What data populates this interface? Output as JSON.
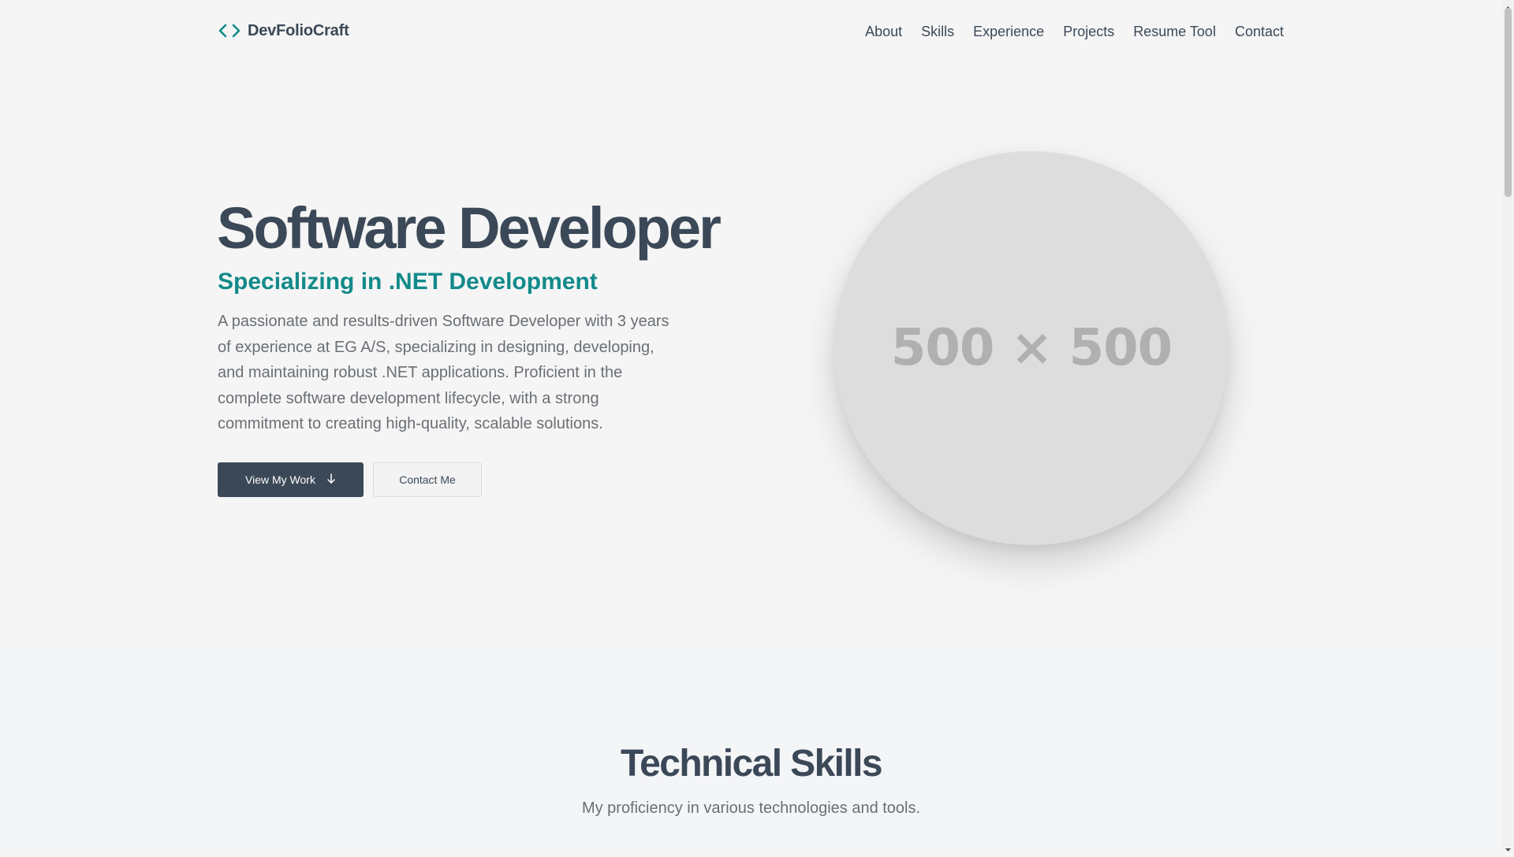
{
  "header": {
    "brand_name": "DevFolioCraft",
    "brand_icon": "code-brackets-icon",
    "nav": [
      {
        "label": "About"
      },
      {
        "label": "Skills"
      },
      {
        "label": "Experience"
      },
      {
        "label": "Projects"
      },
      {
        "label": "Resume Tool"
      },
      {
        "label": "Contact"
      }
    ]
  },
  "hero": {
    "title": "Software Developer",
    "subtitle": "Specializing in .NET Development",
    "description": "A passionate and results-driven Software Developer with 3 years of experience at EG A/S, specializing in designing, developing, and maintaining robust .NET applications. Proficient in the complete software development lifecycle, with a strong commitment to creating high-quality, scalable solutions.",
    "primary_button": {
      "label": "View My Work",
      "icon": "arrow-down-icon"
    },
    "secondary_button": {
      "label": "Contact Me"
    },
    "image_placeholder": "500 × 500"
  },
  "skills": {
    "title": "Technical Skills",
    "subtitle": "My proficiency in various technologies and tools."
  },
  "colors": {
    "text_dark": "#3b4857",
    "accent_teal": "#128a8a",
    "text_muted": "#6a6f75",
    "page_bg": "#f5f5f5"
  }
}
